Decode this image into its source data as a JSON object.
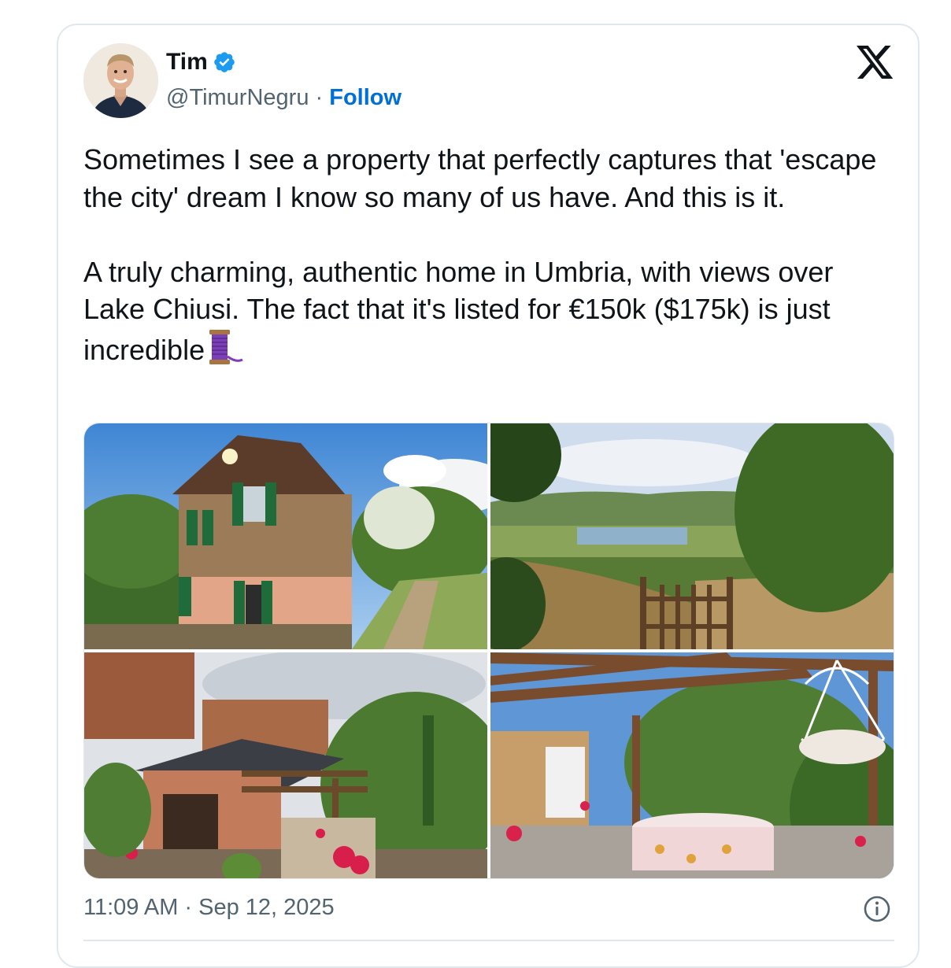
{
  "author": {
    "name": "Tim",
    "handle": "@TimurNegru",
    "separator": " · ",
    "follow_label": "Follow",
    "verified": true,
    "accent_color": "#1d9bf0"
  },
  "platform_icon": "x-logo-icon",
  "tweet": {
    "text": "Sometimes I see a property that perfectly captures that 'escape the city' dream I know so many of us have. And this is it.\n\nA truly charming, authentic home in Umbria, with views over Lake Chiusi. The fact that it's listed for €150k ($175k) is just incredible",
    "trailing_emoji": "spool-of-thread-icon"
  },
  "media": [
    {
      "name": "photo-house-exterior"
    },
    {
      "name": "photo-lake-view"
    },
    {
      "name": "photo-village-garden"
    },
    {
      "name": "photo-pergola-patio"
    }
  ],
  "meta": {
    "timestamp": "11:09 AM · Sep 12, 2025",
    "info_icon": "info-icon"
  }
}
